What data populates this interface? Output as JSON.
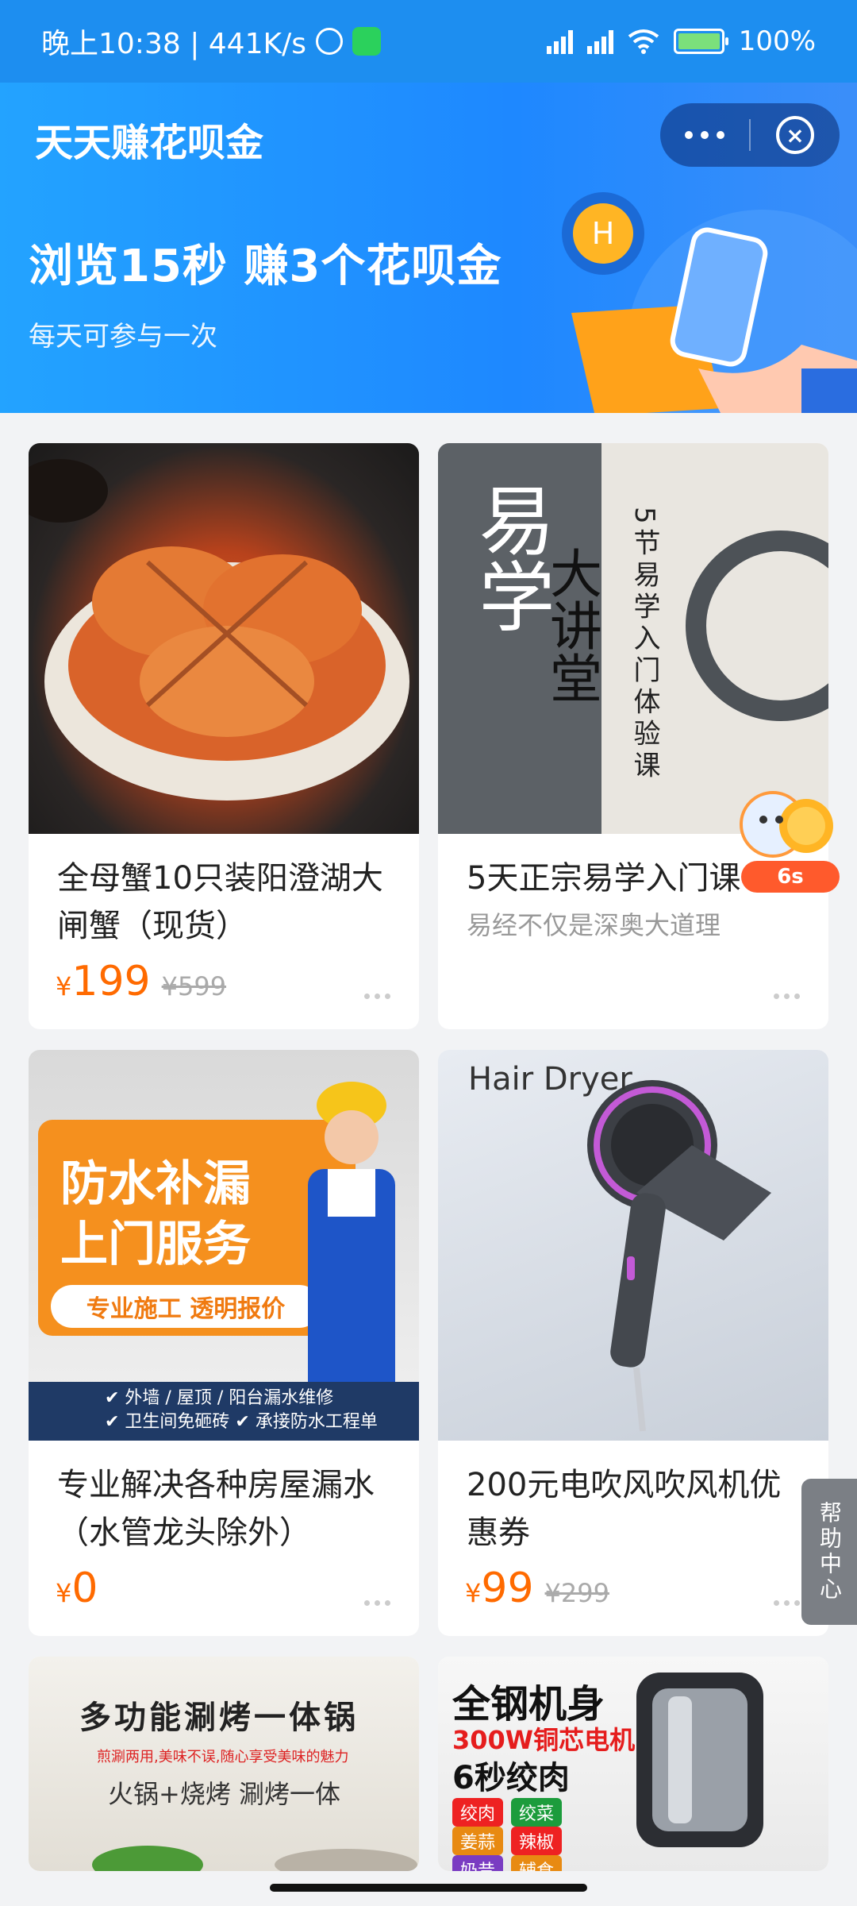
{
  "status_bar": {
    "time": "晚上10:38 | 441K/s",
    "battery": "100%"
  },
  "header": {
    "title": "天天赚花呗金",
    "headline": "浏览15秒 赚3个花呗金",
    "subline": "每天可参与一次"
  },
  "countdown": "6s",
  "products": [
    {
      "title": "全母蟹10只装阳澄湖大闸蟹（现货）",
      "price": "199",
      "original_price": "¥599",
      "image": "crab"
    },
    {
      "title": "5天正宗易学入门课",
      "subtitle": "易经不仅是深奥大道理",
      "image": "yixue",
      "image_text": {
        "big": "易学",
        "col": "5节易学入门体验课",
        "col2": "大讲堂"
      }
    },
    {
      "title": "专业解决各种房屋漏水（水管龙头除外）",
      "price": "0",
      "image": "waterproof",
      "image_text": {
        "line1": "防水补漏",
        "line2": "上门服务",
        "tag": "专业施工  透明报价",
        "footer1": "✔ 外墙 / 屋顶 / 阳台漏水维修",
        "footer2": "✔ 卫生间免砸砖  ✔ 承接防水工程单"
      }
    },
    {
      "title": "200元电吹风吹风机优惠券",
      "price": "99",
      "original_price": "¥299",
      "image": "hair-dryer",
      "image_text": {
        "label": "Hair Dryer"
      }
    },
    {
      "title": "",
      "image": "hotpot",
      "image_text": {
        "line1": "多功能涮烤一体锅",
        "line2": "煎涮两用,美味不误,随心享受美味的魅力",
        "line3": "火锅+烧烤  涮烤一体"
      }
    },
    {
      "title": "",
      "image": "grinder",
      "image_text": {
        "line1": "全钢机身",
        "line2": "300W铜芯电机",
        "line3": "6秒绞肉",
        "pills": [
          "绞肉",
          "绞菜",
          "姜蒜",
          "辣椒",
          "奶昔",
          "辅食"
        ]
      }
    }
  ],
  "price_symbol": "¥",
  "help_tab": "帮助中心",
  "colors": {
    "banner_blue": "#1e88ff",
    "price_orange": "#ff6a00",
    "countdown_red": "#ff5a2c"
  }
}
